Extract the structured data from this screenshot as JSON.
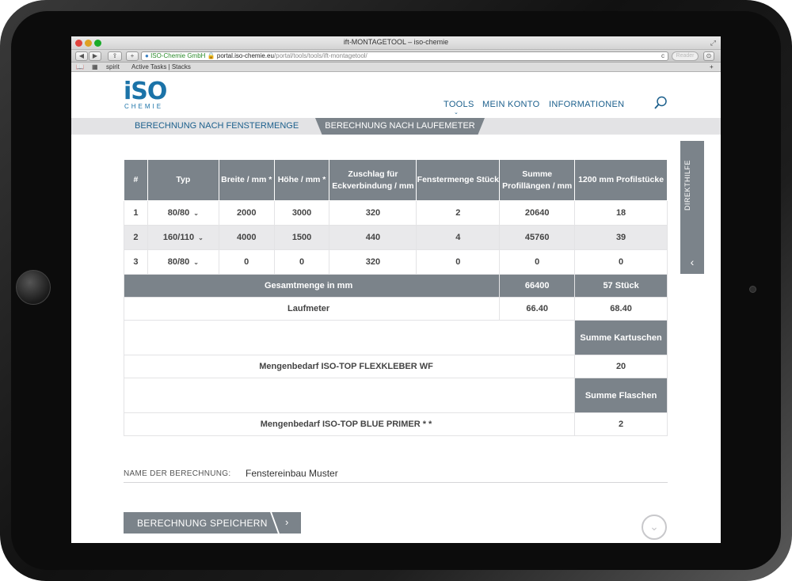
{
  "browser": {
    "window_title": "ift-MONTAGETOOL – iso-chemie",
    "fullscreen_icon": "fullscreen-icon",
    "back_label": "◀",
    "forward_label": "▶",
    "share_label": "⇪",
    "add_label": "+",
    "url_secure_label": "ISO-Chemie GmbH",
    "url_host": "portal.iso-chemie.eu",
    "url_path": "/portal/tools/tools/ift-montagetool/",
    "reload_label": "c",
    "reader_label": "Reader",
    "download_label": "⊙",
    "bookmarks": [
      "spirit",
      "Active Tasks | Stacks"
    ],
    "new_tab_label": "+"
  },
  "site": {
    "logo_text": "iSO",
    "logo_sub": "CHEMIE",
    "nav": [
      "TOOLS",
      "MEIN KONTO",
      "INFORMATIONEN"
    ],
    "nav_caret": "⌄"
  },
  "tabs": {
    "active": "BERECHNUNG NACH FENSTERMENGE",
    "inactive": "BERECHNUNG NACH LAUFEMETER"
  },
  "side_tab": {
    "label": "DIREKTHILFE",
    "arrow": "‹"
  },
  "table": {
    "headers": [
      "#",
      "Typ",
      "Breite / mm *",
      "Höhe / mm *",
      "Zuschlag für Eckverbindung / mm",
      "Fenstermenge Stück",
      "Summe Profillängen / mm",
      "1200 mm Profilstücke"
    ],
    "rows": [
      {
        "num": "1",
        "typ": "80/80",
        "breite": "2000",
        "hoehe": "3000",
        "zuschlag": "320",
        "menge": "2",
        "summe": "20640",
        "stuecke": "18"
      },
      {
        "num": "2",
        "typ": "160/110",
        "breite": "4000",
        "hoehe": "1500",
        "zuschlag": "440",
        "menge": "4",
        "summe": "45760",
        "stuecke": "39"
      },
      {
        "num": "3",
        "typ": "80/80",
        "breite": "0",
        "hoehe": "0",
        "zuschlag": "320",
        "menge": "0",
        "summe": "0",
        "stuecke": "0"
      }
    ],
    "chevron": "⌄",
    "gesamt_label": "Gesamtmenge in mm",
    "gesamt_mm": "66400",
    "gesamt_stueck": "57 Stück",
    "laufmeter_label": "Laufmeter",
    "laufmeter_a": "66.40",
    "laufmeter_b": "68.40",
    "kartuschen_header": "Summe Kartuschen",
    "flexkleber_label": "Mengenbedarf ISO-TOP FLEXKLEBER WF",
    "flexkleber_value": "20",
    "flaschen_header": "Summe Flaschen",
    "primer_label": "Mengenbedarf ISO-TOP BLUE PRIMER * *",
    "primer_value": "2"
  },
  "form": {
    "name_label": "NAME DER BERECHNUNG:",
    "name_value": "Fenstereinbau Muster",
    "save_label": "BERECHNUNG SPEICHERN",
    "save_arrow": "›",
    "scroll_down": "⌄"
  },
  "colors": {
    "brand_blue": "#1b73a8",
    "header_gray": "#7b838a",
    "tab_bg": "#e3e3e5"
  }
}
